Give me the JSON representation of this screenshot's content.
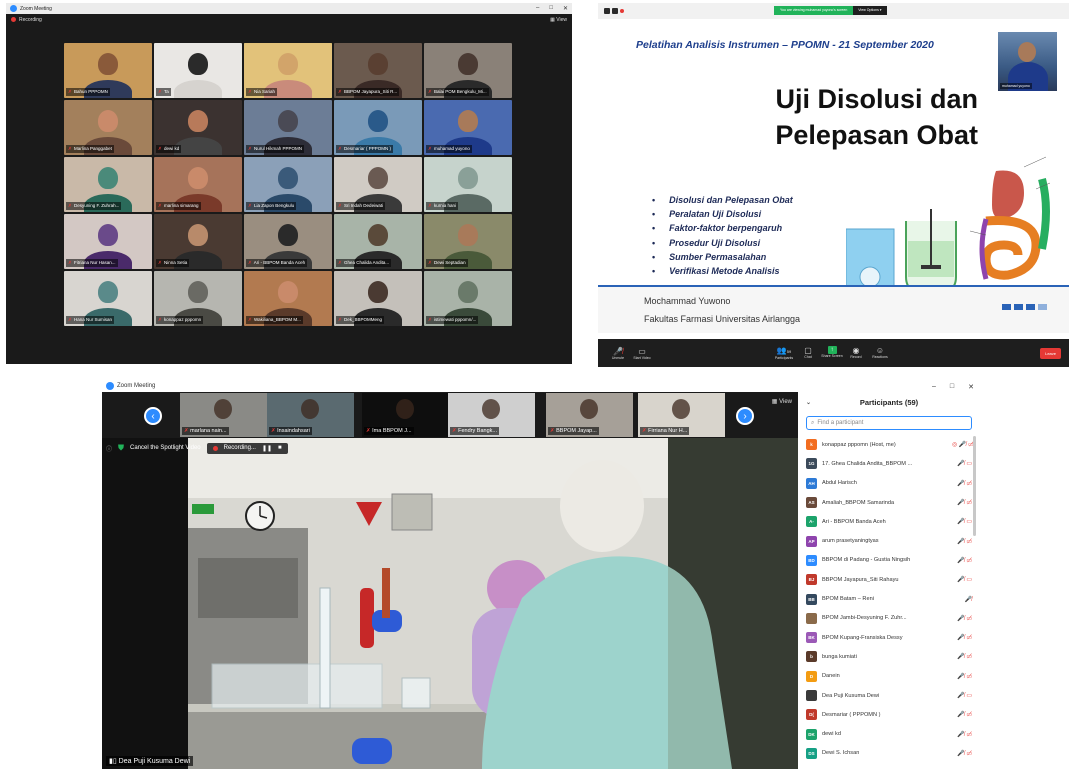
{
  "gallery": {
    "window_title": "Zoom Meeting",
    "recording_label": "Recording",
    "view_label": "View",
    "tiles": [
      {
        "name": "Bahun PPPOMN",
        "wall": "#c89a5a",
        "skin": "#8a5a3a",
        "shirt": "#2f3a5a"
      },
      {
        "name": "Ta",
        "wall": "#e9e7e4",
        "skin": "#2a2a2a",
        "shirt": "#d6d3cf"
      },
      {
        "name": "Nia Sariah",
        "wall": "#e2c27a",
        "skin": "#d2a46a",
        "shirt": "#c98b7b",
        "active": true
      },
      {
        "name": "BBPOM Jayapura_Siti R...",
        "wall": "#6b5a4e",
        "skin": "#5a4032",
        "shirt": "#3a2a26"
      },
      {
        "name": "Balai POM Bengkulu_Mi...",
        "wall": "#8a8178",
        "skin": "#4a3a33",
        "shirt": "#2a2a2a"
      },
      {
        "name": "Marlina Panggabet",
        "wall": "#a3805c",
        "skin": "#c98a6a",
        "shirt": "#6a4a3a"
      },
      {
        "name": "dewi kd",
        "wall": "#3b3230",
        "skin": "#b87a5a",
        "shirt": "#444"
      },
      {
        "name": "Nurul Hikmah PPPOMN",
        "wall": "#6c7d96",
        "skin": "#4a4a55",
        "shirt": "#2d2d38"
      },
      {
        "name": "Desmariar ( PPPOMN )",
        "wall": "#7a9ab8",
        "skin": "#2a5a8a",
        "shirt": "#3a7aa8"
      },
      {
        "name": "muhamad yuyono",
        "wall": "#4a6ab0",
        "skin": "#a87a5a",
        "shirt": "#1e3a8a"
      },
      {
        "name": "Desyuning F. Zuhrah...",
        "wall": "#c9b9a8",
        "skin": "#4a8a7a",
        "shirt": "#2a6a5a"
      },
      {
        "name": "marlina simarang",
        "wall": "#a6735a",
        "skin": "#c98a6a",
        "shirt": "#7a3a2a"
      },
      {
        "name": "Lia Zapon Bengkulu",
        "wall": "#8ba0b8",
        "skin": "#3a5a7a",
        "shirt": "#2a4a6a"
      },
      {
        "name": "Sri Indah Dedeiwati",
        "wall": "#d0cbc4",
        "skin": "#6a5a52",
        "shirt": "#3a3a3a"
      },
      {
        "name": "kurnia hani",
        "wall": "#c6d3cc",
        "skin": "#8aa098",
        "shirt": "#5a6a64"
      },
      {
        "name": "Fitriana Nur Hasan...",
        "wall": "#d3c8c4",
        "skin": "#6a4a8a",
        "shirt": "#4a2a6a"
      },
      {
        "name": "Ninna Setia",
        "wall": "#4a3a32",
        "skin": "#b88a6a",
        "shirt": "#2a2a2a"
      },
      {
        "name": "Ari - BBPOM Banda Aceh",
        "wall": "#9a8e80",
        "skin": "#2a2a2a",
        "shirt": "#3a3a3a"
      },
      {
        "name": "Ghea Chalida Andita...",
        "wall": "#a8b4a8",
        "skin": "#5a4a3a",
        "shirt": "#2a2a2a"
      },
      {
        "name": "Dewi Septadian",
        "wall": "#8a8a6a",
        "skin": "#a87a5a",
        "shirt": "#4a5a3a"
      },
      {
        "name": "Hana Nur Sumisan",
        "wall": "#d8d5d0",
        "skin": "#5a8a8a",
        "shirt": "#3a6a6a"
      },
      {
        "name": "konappaz pppomn",
        "wall": "#b6b6b0",
        "skin": "#6a6a64",
        "shirt": "#4a4a44"
      },
      {
        "name": "Wakiliana_BBPOM M...",
        "wall": "#b27a50",
        "skin": "#c98a6a",
        "shirt": "#5a3a2a"
      },
      {
        "name": "Dek_BBPOMMeng",
        "wall": "#c4c0ba",
        "skin": "#4a3a32",
        "shirt": "#2a2a2a"
      },
      {
        "name": "istimewati pppomn/...",
        "wall": "#a9b3a8",
        "skin": "#6a7a6a",
        "shirt": "#3a4a3a"
      }
    ]
  },
  "share": {
    "banner_text": "You are viewing muhamad yuyono's screen",
    "view_options": "View Options ▾",
    "slide": {
      "subtitle": "Pelatihan  Analisis Instrumen – PPOMN - 21 September 2020",
      "title_line1": "Uji Disolusi dan",
      "title_line2": "Pelepasan Obat",
      "bullets": [
        "Disolusi dan Pelepasan Obat",
        "Peralatan Uji Disolusi",
        "Faktor-faktor berpengaruh",
        "Prosedur Uji Disolusi",
        "Sumber Permasalahan",
        "Verifikasi Metode Analisis"
      ],
      "author": "Mochammad Yuwono",
      "affiliation": "Fakultas Farmasi Universitas Airlangga"
    },
    "presenter_name": "muhamad yuyono",
    "toolbar": {
      "unmute": "Unmute",
      "start_video": "Start Video",
      "participants": "Participants",
      "participants_count": "59",
      "chat": "Chat",
      "share_screen": "Share Screen",
      "record": "Record",
      "reactions": "Reactions",
      "leave": "Leave"
    }
  },
  "spotlight": {
    "window_title": "Zoom Meeting",
    "view_label": "View",
    "cancel_spotlight": "Cancel the Spotlight Video",
    "recording_label": "Recording...",
    "speaker_name": "Dea Puji Kusuma Dewi",
    "thumbnails": [
      {
        "name": "marlana nain...",
        "wall": "#8a8a86"
      },
      {
        "name": "Insaindahsari",
        "wall": "#5a6a70"
      },
      {
        "name": "Ima BBPOM J...",
        "wall": "#0e0e0e"
      },
      {
        "name": "Fendry Bangk...",
        "wall": "#cfcfcf"
      },
      {
        "name": "BBPOM Jayap...",
        "wall": "#a6a098"
      },
      {
        "name": "Firriana Nur H...",
        "wall": "#d8d4cc"
      }
    ],
    "participants_title": "Participants (59)",
    "search_placeholder": "Find a participant",
    "participants": [
      {
        "initials": "k",
        "color": "#f26d21",
        "name": "konappaz pppomn  (Host, me)",
        "status": "◎ 🎤̸ ▭̸"
      },
      {
        "initials": "1G",
        "color": "#3b4a5a",
        "name": "17. Ghea Chalida Andita_BBPOM ...",
        "status": "🎤̸ ▭"
      },
      {
        "initials": "AH",
        "color": "#2d7ad6",
        "name": "Abdul Harisch",
        "status": "🎤̸ ▭̸"
      },
      {
        "initials": "AS",
        "color": "#6a4a3a",
        "name": "Amaliah_BBPOM Samarinda",
        "status": "🎤̸ ▭̸"
      },
      {
        "initials": "A-",
        "color": "#1ca36b",
        "name": "Ari - BBPOM Banda Aceh",
        "status": "🎤̸ ▭"
      },
      {
        "initials": "AP",
        "color": "#8e44ad",
        "name": "arum prasetyaningtyas",
        "status": "🎤̸ ▭̸"
      },
      {
        "initials": "BD",
        "color": "#2d8cff",
        "name": "BBPOM di Padang - Gustia Ningsih",
        "status": "🎤̸ ▭̸"
      },
      {
        "initials": "BJ",
        "color": "#c0392b",
        "name": "BBPOM Jayapura_Siti Rahayu",
        "status": "🎤̸ ▭"
      },
      {
        "initials": "BB",
        "color": "#34495e",
        "name": "BPOM Batam – Reni",
        "status": "🎤̸"
      },
      {
        "initials": "",
        "color": "#8a6a4a",
        "name": "BPOM Jambi-Desyuning F. Zuhr...",
        "status": "🎤̸ ▭̸"
      },
      {
        "initials": "BK",
        "color": "#9b59b6",
        "name": "BPOM Kupang-Fransiska Dessy",
        "status": "🎤̸ ▭̸"
      },
      {
        "initials": "b",
        "color": "#5a3a2a",
        "name": "bunga kumiati",
        "status": "🎤̸ ▭̸"
      },
      {
        "initials": "D",
        "color": "#f39c12",
        "name": "Danein",
        "status": "🎤̸ ▭̸"
      },
      {
        "initials": "",
        "color": "#3a3a3a",
        "name": "Dea Puji Kusuma Dewi",
        "status": "🎤̸ ▭"
      },
      {
        "initials": "D(",
        "color": "#c0392b",
        "name": "Desmariar ( PPPOMN )",
        "status": "🎤̸ ▭̸"
      },
      {
        "initials": "DK",
        "color": "#1ca36b",
        "name": "dewi kd",
        "status": "🎤̸ ▭̸"
      },
      {
        "initials": "DS",
        "color": "#16a085",
        "name": "Dewi S. Ichsan",
        "status": "🎤̸ ▭̸"
      }
    ]
  }
}
